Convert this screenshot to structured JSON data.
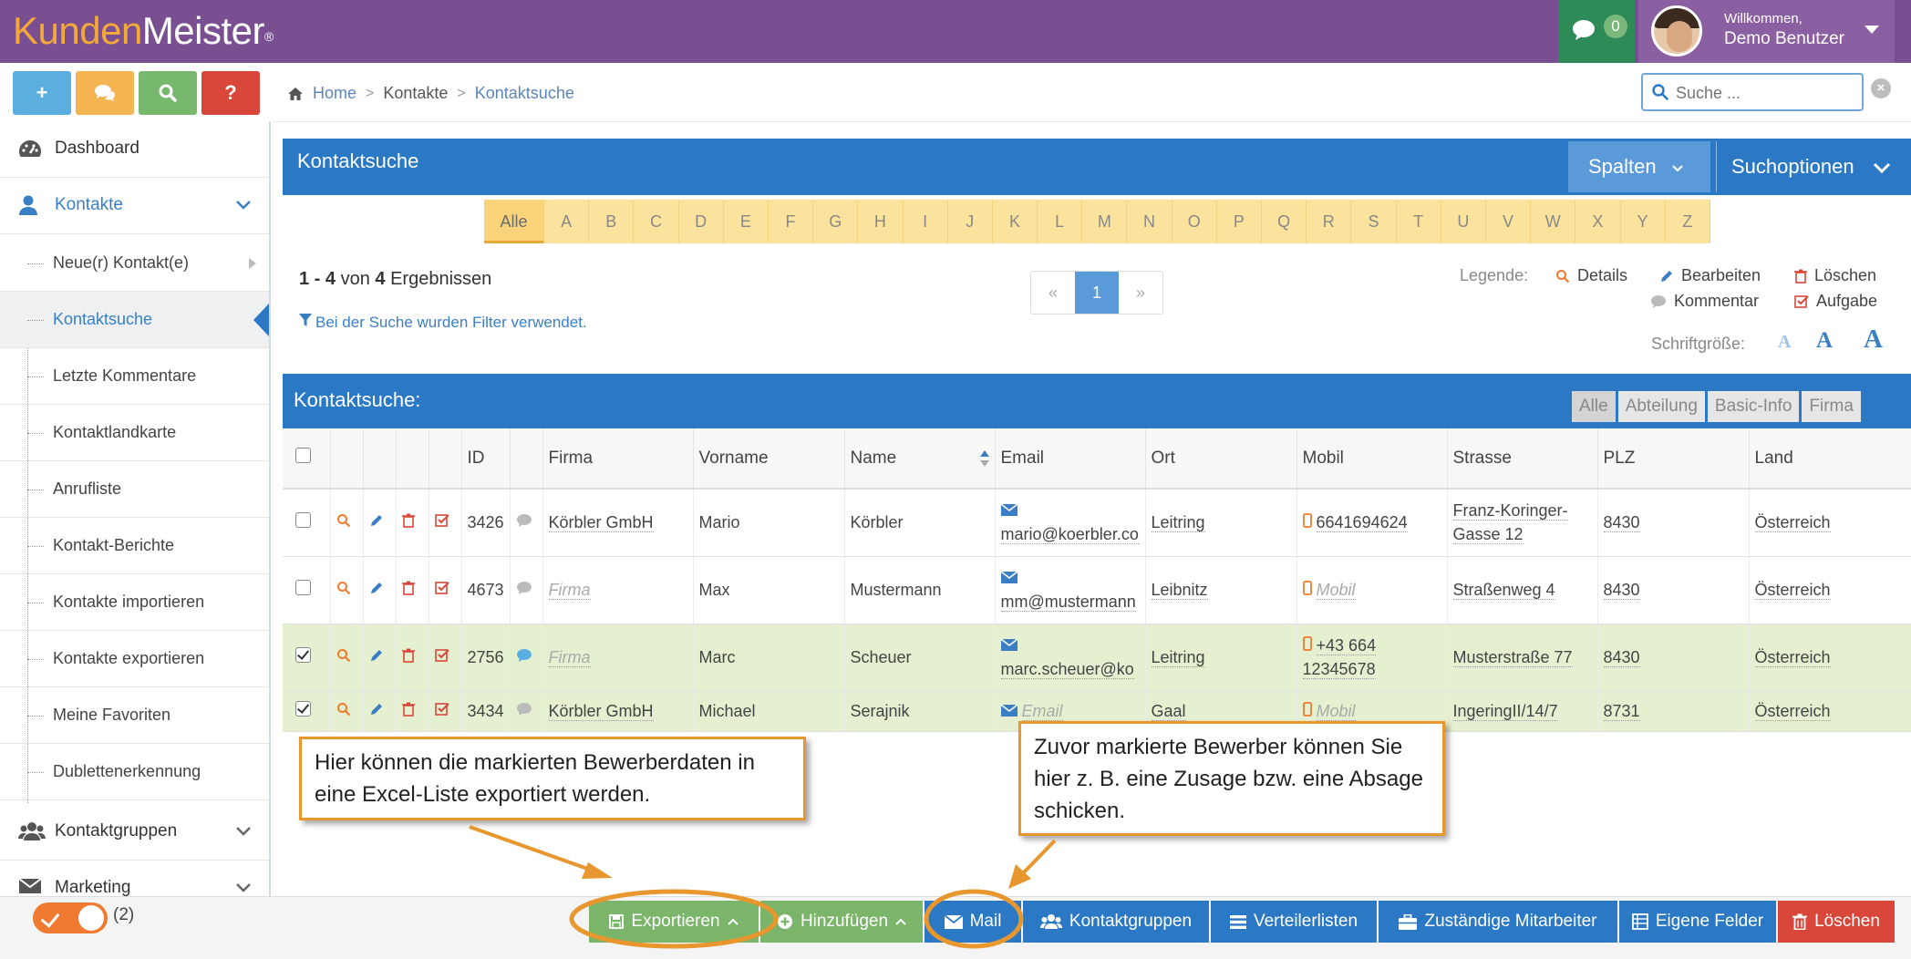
{
  "app": {
    "logo_a": "Kunden",
    "logo_b": "Meister",
    "logo_reg": "®",
    "chat_count": "0",
    "welcome": "Willkommen,",
    "user_name": "Demo Benutzer"
  },
  "tools": {
    "add": "+",
    "help": "?"
  },
  "sidebar": {
    "dashboard": "Dashboard",
    "kontakte": "Kontakte",
    "items": [
      "Neue(r) Kontakt(e)",
      "Kontaktsuche",
      "Letzte Kommentare",
      "Kontaktlandkarte",
      "Anrufliste",
      "Kontakt-Berichte",
      "Kontakte importieren",
      "Kontakte exportieren",
      "Meine Favoriten",
      "Dublettenerkennung"
    ],
    "kontaktgruppen": "Kontaktgruppen",
    "marketing": "Marketing"
  },
  "breadcrumb": {
    "home": "Home",
    "kontakte": "Kontakte",
    "current": "Kontaktsuche",
    "sep": ">"
  },
  "search": {
    "placeholder": "Suche ...",
    "clear": "×"
  },
  "panel": {
    "title": "Kontaktsuche",
    "spalten": "Spalten",
    "suchoptionen": "Suchoptionen"
  },
  "alphabet": [
    "Alle",
    "A",
    "B",
    "C",
    "D",
    "E",
    "F",
    "G",
    "H",
    "I",
    "J",
    "K",
    "L",
    "M",
    "N",
    "O",
    "P",
    "Q",
    "R",
    "S",
    "T",
    "U",
    "V",
    "W",
    "X",
    "Y",
    "Z"
  ],
  "results": {
    "range": "1 - 4",
    "von": "von",
    "total": "4",
    "word": "Ergebnissen",
    "filter_note": "Bei der Suche wurden Filter verwendet."
  },
  "pager": {
    "prev": "«",
    "page": "1",
    "next": "»"
  },
  "legend": {
    "label": "Legende:",
    "details": "Details",
    "bearbeiten": "Bearbeiten",
    "loeschen": "Löschen",
    "kommentar": "Kommentar",
    "aufgabe": "Aufgabe",
    "font_label": "Schriftgröße:",
    "font_glyph": "A"
  },
  "table": {
    "title": "Kontaktsuche:",
    "tabs": [
      "Alle",
      "Abteilung",
      "Basic-Info",
      "Firma"
    ],
    "columns": [
      "ID",
      "Firma",
      "Vorname",
      "Name",
      "Email",
      "Ort",
      "Mobil",
      "Strasse",
      "PLZ",
      "Land"
    ],
    "rows": [
      {
        "id": "3426",
        "firma": "Körbler GmbH",
        "vorname": "Mario",
        "name": "Körbler",
        "email": "mario@koerbler.co",
        "ort": "Leitring",
        "mobil": "6641694624",
        "strasse": "Franz-Koringer-Gasse 12",
        "plz": "8430",
        "land": "Österreich",
        "selected": false,
        "firma_placeholder": false,
        "email_placeholder": false,
        "mobil_placeholder": false
      },
      {
        "id": "4673",
        "firma": "Firma",
        "vorname": "Max",
        "name": "Mustermann",
        "email": "mm@mustermann",
        "ort": "Leibnitz",
        "mobil": "Mobil",
        "strasse": "Straßenweg 4",
        "plz": "8430",
        "land": "Österreich",
        "selected": false,
        "firma_placeholder": true,
        "email_placeholder": false,
        "mobil_placeholder": true
      },
      {
        "id": "2756",
        "firma": "Firma",
        "vorname": "Marc",
        "name": "Scheuer",
        "email": "marc.scheuer@ko",
        "ort": "Leitring",
        "mobil": "+43 664 12345678",
        "strasse": "Musterstraße 77",
        "plz": "8430",
        "land": "Österreich",
        "selected": true,
        "firma_placeholder": true,
        "email_placeholder": false,
        "mobil_placeholder": false
      },
      {
        "id": "3434",
        "firma": "Körbler GmbH",
        "vorname": "Michael",
        "name": "Serajnik",
        "email": "Email",
        "ort": "Gaal",
        "mobil": "Mobil",
        "strasse": "IngeringII/14/7",
        "plz": "8731",
        "land": "Österreich",
        "selected": true,
        "firma_placeholder": false,
        "email_placeholder": true,
        "mobil_placeholder": true
      }
    ]
  },
  "bottombar": {
    "count": "(2)",
    "buttons": [
      {
        "label": "Exportieren",
        "color": "#7ab56a"
      },
      {
        "label": "Hinzufügen",
        "color": "#7ab56a"
      },
      {
        "label": "Mail",
        "color": "#2b78c5"
      },
      {
        "label": "Kontaktgruppen",
        "color": "#2b78c5"
      },
      {
        "label": "Verteilerlisten",
        "color": "#2b78c5"
      },
      {
        "label": "Zuständige Mitarbeiter",
        "color": "#2b78c5"
      },
      {
        "label": "Eigene Felder",
        "color": "#2b78c5"
      },
      {
        "label": "Löschen",
        "color": "#d9473a"
      }
    ]
  },
  "callouts": {
    "export_note": "Hier können die markierten Bewerberdaten in eine Excel-Liste exportiert werden.",
    "mail_note": "Zuvor markierte Bewerber können Sie hier z. B. eine Zusage bzw. eine Absage schicken."
  },
  "colors": {
    "topbar": "#7a4f92",
    "primary": "#2b78c5",
    "accent": "#f3a83a",
    "callout_border": "#e8962e",
    "danger": "#d9473a",
    "success": "#7ab56a"
  }
}
